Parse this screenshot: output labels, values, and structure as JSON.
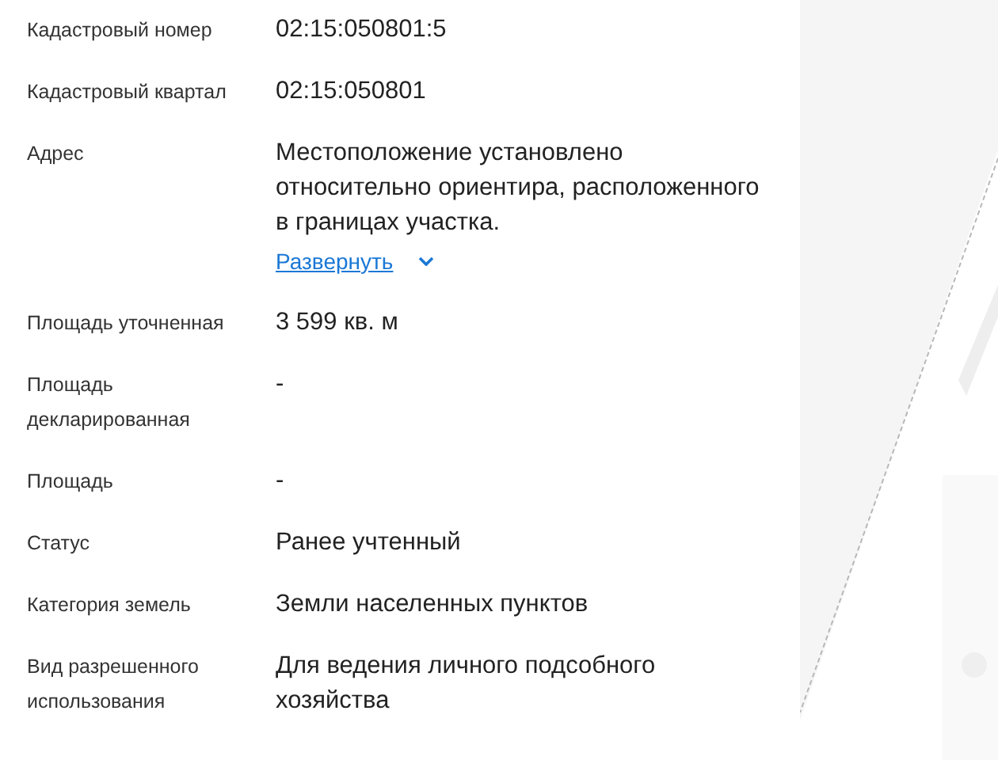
{
  "properties": [
    {
      "label": "Кадастровый номер",
      "value": "02:15:050801:5"
    },
    {
      "label": "Кадастровый квартал",
      "value": "02:15:050801"
    },
    {
      "label": "Адрес",
      "value": "Местоположение установлено относительно ориентира, расположенного в границах участка.",
      "expand_link": "Развернуть"
    },
    {
      "label": "Площадь уточненная",
      "value": "3 599 кв. м"
    },
    {
      "label": "Площадь декларированная",
      "value": "-"
    },
    {
      "label": "Площадь",
      "value": "-"
    },
    {
      "label": "Статус",
      "value": "Ранее учтенный"
    },
    {
      "label": "Категория земель",
      "value": "Земли населенных пунктов"
    },
    {
      "label": "Вид разрешенного использования",
      "value": "Для ведения личного подсобного хозяйства"
    }
  ]
}
